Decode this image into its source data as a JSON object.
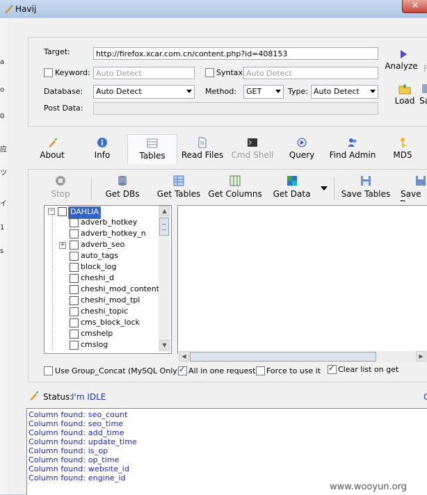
{
  "window": {
    "title": "Havij"
  },
  "left_strip_glyphs": [
    "a",
    "o",
    "0",
    "应",
    "ツ",
    "イ",
    "1",
    "s"
  ],
  "target": {
    "target_label": "Target:",
    "target_value": "http://firefox.xcar.com.cn/content.php?id=408153",
    "keyword_label": "Keyword:",
    "keyword_placeholder": "Auto Detect",
    "syntax_label": "Syntax:",
    "syntax_placeholder": "Auto Detect",
    "database_label": "Database:",
    "database_value": "Auto Detect",
    "method_label": "Method:",
    "method_value": "GET",
    "type_label": "Type:",
    "type_value": "Auto Detect",
    "postdata_label": "Post Data:",
    "analyze_label": "Analyze",
    "load_label": "Load",
    "save_partial_label": "Sa",
    "right_partial": "F"
  },
  "tabs": [
    {
      "label": "About",
      "icon": "carrot-icon"
    },
    {
      "label": "Info",
      "icon": "info-icon"
    },
    {
      "label": "Tables",
      "icon": "table-icon",
      "active": true
    },
    {
      "label": "Read Files",
      "icon": "document-icon"
    },
    {
      "label": "Cmd Shell",
      "icon": "terminal-icon",
      "disabled": true
    },
    {
      "label": "Query",
      "icon": "query-icon"
    },
    {
      "label": "Find Admin",
      "icon": "users-icon"
    },
    {
      "label": "MD5",
      "icon": "key-icon"
    }
  ],
  "toolbar": {
    "stop": "Stop",
    "get_dbs": "Get DBs",
    "get_tables": "Get Tables",
    "get_columns": "Get Columns",
    "get_data": "Get Data",
    "save_tables": "Save Tables",
    "save_data_partial": "Save D"
  },
  "tree": {
    "root": "DAHLIA",
    "items": [
      "adverb_hotkey",
      "adverb_hotkey_n",
      "adverb_seo",
      "auto_tags",
      "block_log",
      "cheshi_d",
      "cheshi_mod_content",
      "cheshi_mod_tpl",
      "cheshi_topic",
      "cms_block_lock",
      "cmshelp",
      "cmslog"
    ]
  },
  "options": {
    "group_concat": "Use Group_Concat (MySQL Only)",
    "all_in_one": "All in one request.",
    "force": "Force to use it",
    "clear_list": "Clear list on get"
  },
  "status": {
    "label": "Status:",
    "value": "I'm IDLE",
    "right_partial": "C"
  },
  "log": [
    "Column found: seo_count",
    "Column found: seo_time",
    "Column found: add_time",
    "Column found: update_time",
    "Column found: is_op",
    "Column found: op_time",
    "Column found: website_id",
    "Column found: engine_id"
  ],
  "watermark": "www.wooyun.org",
  "colors": {
    "accent": "#1b33b0",
    "selection": "#3163c5",
    "log_text": "#1a23b5"
  }
}
